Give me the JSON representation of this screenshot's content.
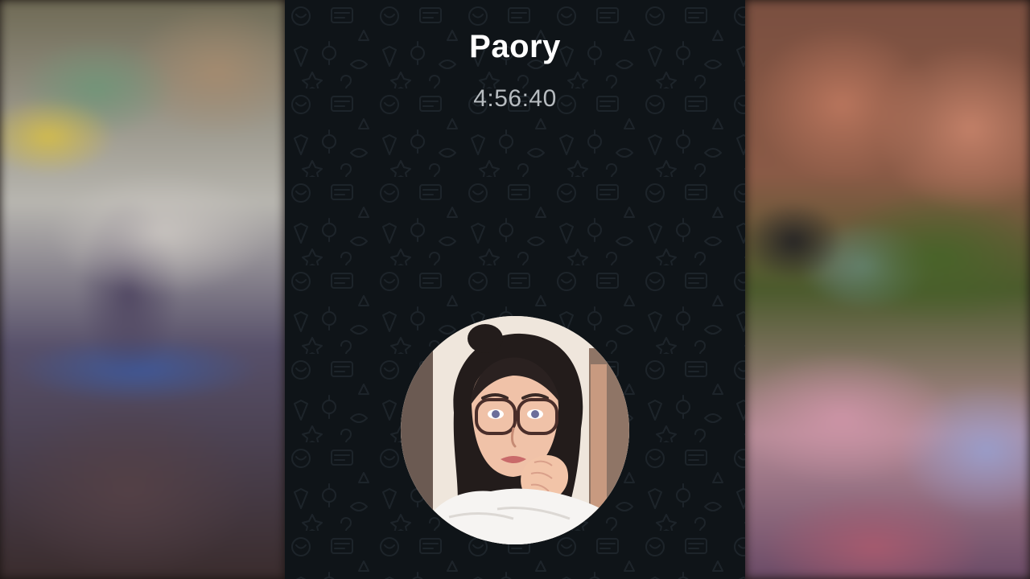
{
  "call": {
    "caller_name": "Paory",
    "duration": "4:56:40"
  },
  "icons": {
    "avatar": "profile-photo",
    "wallpaper": "chat-doodle-pattern"
  },
  "colors": {
    "call_background": "#0f1418",
    "caller_name": "#ffffff",
    "timer": "#b7bcc0"
  }
}
